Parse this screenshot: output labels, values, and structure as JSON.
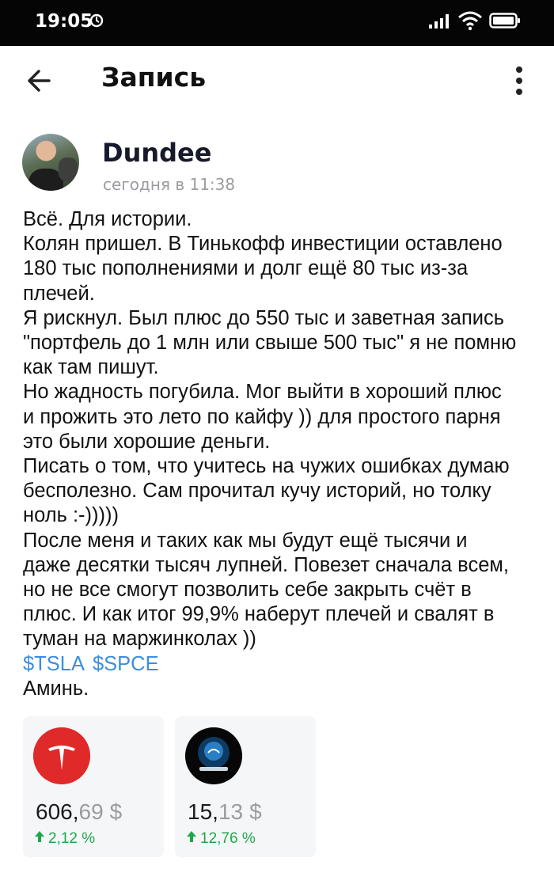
{
  "status_bar": {
    "time": "19:05",
    "icons": [
      "alarm-icon",
      "signal-icon",
      "wifi-icon",
      "battery-icon"
    ]
  },
  "appbar": {
    "title": "Запись",
    "back_icon": "arrow-left-icon",
    "menu_icon": "more-vertical-icon"
  },
  "post": {
    "author": "Dundee",
    "time": "сегодня в 11:38",
    "lines": [
      "Всё. Для истории.",
      "Колян пришел. В Тинькофф инвестиции оставлено",
      "180 тыс пополнениями и долг ещё 80 тыс из-за",
      "плечей.",
      "Я рискнул. Был плюс до 550 тыс и заветная запись",
      "\"портфель до 1 млн или свыше 500 тыс\" я не помню",
      "как там пишут.",
      "Но жадность погубила. Мог выйти в хороший плюс",
      "и прожить это лето по кайфу )) для простого парня",
      "это были хорошие деньги.",
      "Писать о том, что учитесь на чужих ошибках думаю",
      "бесполезно. Сам прочитал кучу историй, но толку",
      "ноль :-)))))",
      "После меня и таких как мы будут ещё тысячи и",
      "даже десятки тысяч лупней. Повезет сначала всем,",
      "но не все смогут позволить себе закрыть счёт в",
      "плюс. И как итог 99,9% наберут плечей и свалят в",
      "туман на маржинколах ))"
    ],
    "tickers": [
      "$TSLA",
      "$SPCE"
    ],
    "closing": "Аминь."
  },
  "cards": [
    {
      "logo": "tesla-logo-icon",
      "price_int": "606,",
      "price_cents": "69",
      "currency": "$",
      "change": "2,12 %",
      "direction": "up"
    },
    {
      "logo": "virgin-galactic-logo-icon",
      "price_int": "15,",
      "price_cents": "13",
      "currency": "$",
      "change": "12,76 %",
      "direction": "up"
    }
  ],
  "colors": {
    "link": "#3a8ee0",
    "positive": "#1fa84a",
    "muted": "#9a9ca0",
    "tesla_red": "#e02a2a"
  }
}
